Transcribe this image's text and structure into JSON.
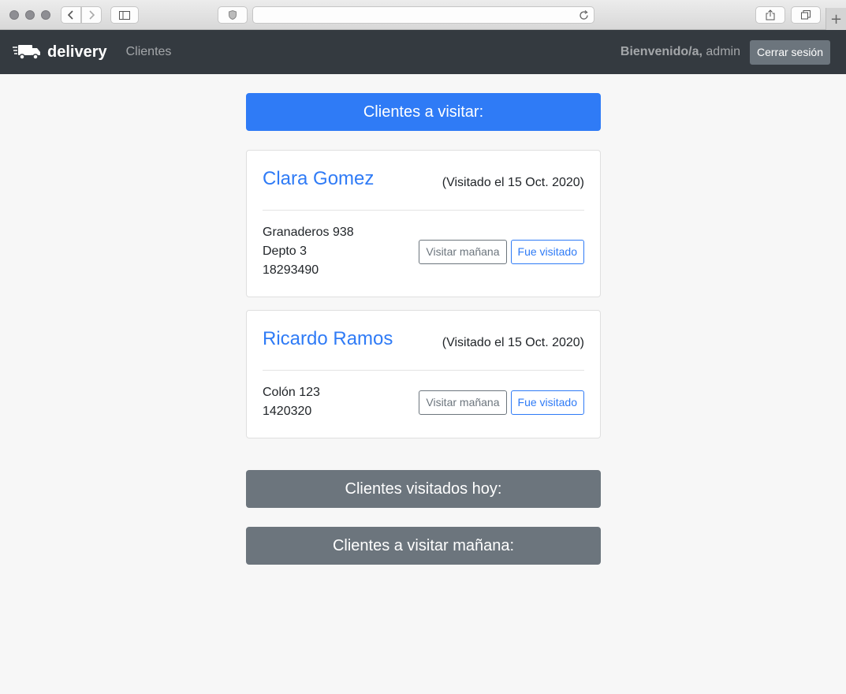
{
  "navbar": {
    "brand": "delivery",
    "nav_link": "Clientes",
    "welcome_prefix": "Bienvenido/a,",
    "welcome_user": "admin",
    "logout_label": "Cerrar sesión"
  },
  "sections": {
    "to_visit": "Clientes a visitar:",
    "visited_today": "Clientes visitados hoy:",
    "visit_tomorrow": "Clientes a visitar mañana:"
  },
  "clients": [
    {
      "name": "Clara Gomez",
      "visited": "(Visitado el 15 Oct. 2020)",
      "address_lines": [
        "Granaderos 938",
        "Depto 3",
        "18293490"
      ],
      "btn_tomorrow": "Visitar mañana",
      "btn_visited": "Fue visitado"
    },
    {
      "name": "Ricardo Ramos",
      "visited": "(Visitado el 15 Oct. 2020)",
      "address_lines": [
        "Colón 123",
        "1420320"
      ],
      "btn_tomorrow": "Visitar mañana",
      "btn_visited": "Fue visitado"
    }
  ],
  "colors": {
    "navbar": "#343a40",
    "primary": "#2f7bf6",
    "secondary": "#6c757d",
    "background": "#f7f7f7"
  }
}
